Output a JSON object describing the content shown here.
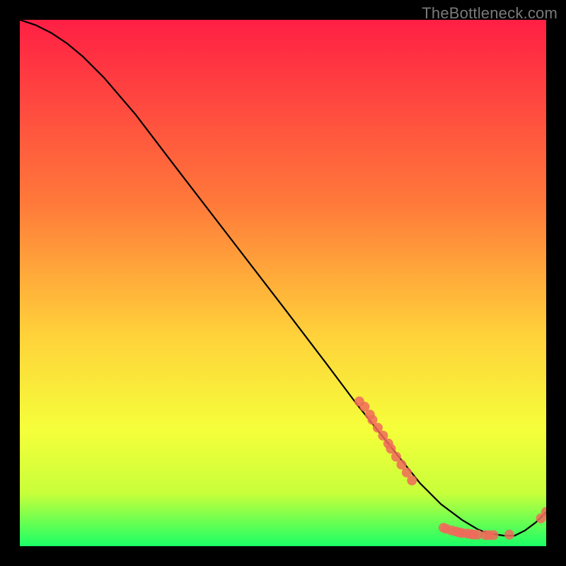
{
  "watermark": "TheBottleneck.com",
  "colors": {
    "gradient_top": "#ff1f44",
    "gradient_upper_mid": "#ff7a3a",
    "gradient_mid": "#ffd23a",
    "gradient_lower_mid": "#f5ff3a",
    "gradient_lower": "#c7ff3a",
    "gradient_bottom": "#1aff66",
    "curve": "#000000",
    "markers": "#f06a5a",
    "frame": "#000000"
  },
  "chart_data": {
    "type": "line",
    "title": "",
    "xlabel": "",
    "ylabel": "",
    "xlim": [
      0,
      100
    ],
    "ylim": [
      0,
      100
    ],
    "curve": {
      "x": [
        0,
        3,
        6,
        9,
        12,
        16,
        22,
        30,
        40,
        50,
        58,
        64,
        68,
        72,
        76,
        80,
        82,
        84,
        86,
        87,
        88,
        90,
        92,
        94,
        96,
        98,
        100
      ],
      "y": [
        100,
        99,
        97.5,
        95.5,
        93,
        89,
        82,
        71.5,
        58.5,
        45.5,
        35,
        27,
        22,
        17,
        12,
        8,
        6.5,
        5,
        3.8,
        3.2,
        2.8,
        2.3,
        2.0,
        2.0,
        3.0,
        4.5,
        6.5
      ]
    },
    "markers": [
      {
        "x": 64.5,
        "y": 27.5
      },
      {
        "x": 65.5,
        "y": 26.5
      },
      {
        "x": 66.5,
        "y": 25.0
      },
      {
        "x": 67.0,
        "y": 24.0
      },
      {
        "x": 68.0,
        "y": 22.5
      },
      {
        "x": 69.0,
        "y": 21.0
      },
      {
        "x": 70.0,
        "y": 19.5
      },
      {
        "x": 70.5,
        "y": 18.5
      },
      {
        "x": 71.5,
        "y": 17.0
      },
      {
        "x": 72.5,
        "y": 15.5
      },
      {
        "x": 73.5,
        "y": 14.0
      },
      {
        "x": 74.5,
        "y": 12.5
      },
      {
        "x": 80.5,
        "y": 3.5
      },
      {
        "x": 81.0,
        "y": 3.3
      },
      {
        "x": 82.0,
        "y": 3.0
      },
      {
        "x": 82.8,
        "y": 2.8
      },
      {
        "x": 83.5,
        "y": 2.6
      },
      {
        "x": 84.0,
        "y": 2.5
      },
      {
        "x": 85.0,
        "y": 2.4
      },
      {
        "x": 85.7,
        "y": 2.3
      },
      {
        "x": 86.2,
        "y": 2.2
      },
      {
        "x": 87.0,
        "y": 2.2
      },
      {
        "x": 88.5,
        "y": 2.1
      },
      {
        "x": 89.2,
        "y": 2.1
      },
      {
        "x": 90.0,
        "y": 2.1
      },
      {
        "x": 93.0,
        "y": 2.2
      },
      {
        "x": 99.0,
        "y": 5.3
      },
      {
        "x": 100.0,
        "y": 6.5
      }
    ]
  }
}
